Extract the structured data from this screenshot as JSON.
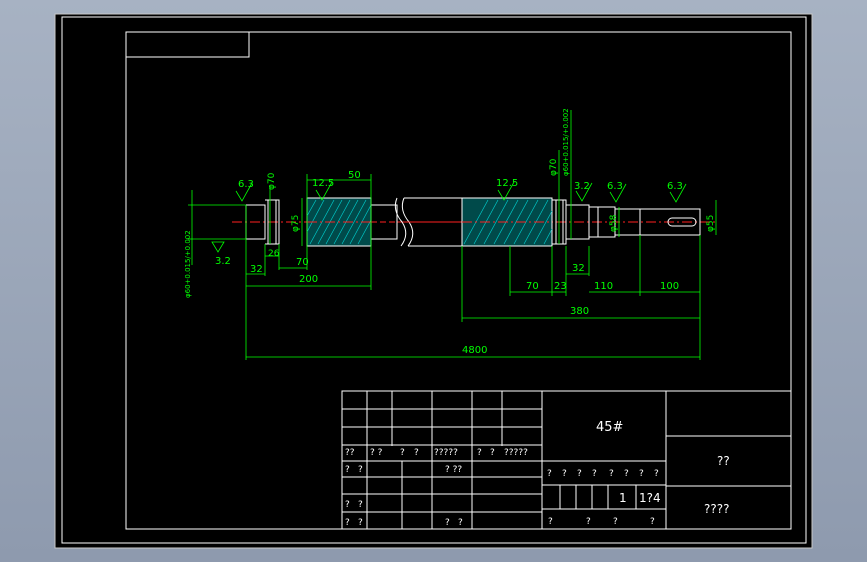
{
  "colors": {
    "viewport_bg": "#000000",
    "frame": "#ffffff",
    "dimension": "#00ff00",
    "centerline": "#ff2020",
    "hatch": "#00c8c8",
    "text": "#ffffff"
  },
  "drawing": {
    "roughness": {
      "r1": "6.3",
      "r2": "12.5",
      "r3": "12.5",
      "r4": "3.2",
      "r5": "6.3",
      "r6": "6.3",
      "r7": "3.2"
    },
    "diameters": {
      "d70_left": "φ70",
      "d75": "φ75",
      "d70_right": "φ70",
      "d60_right": "φ60+0.015/+0.002",
      "d58": "φ58",
      "d55": "φ55",
      "d60_left": "φ60+0.015/+0.002"
    },
    "dims": {
      "d50": "50",
      "d26": "26",
      "d32_left": "32",
      "d70_left": "70",
      "d200": "200",
      "d70_right": "70",
      "d23": "23",
      "d32_right": "32",
      "d110": "110",
      "d100": "100",
      "d380": "380",
      "d4800": "4800"
    }
  },
  "title_block": {
    "material": "45#",
    "part_name": "??",
    "drawing_no": "????",
    "left_row1": [
      "??",
      "? ?",
      "?",
      "?",
      "?????",
      "?",
      "?",
      "?????"
    ],
    "left_row2": [
      "?",
      "?",
      "? ??"
    ],
    "left_row3": [
      "?",
      "?"
    ],
    "left_row4": [
      "?",
      "?",
      "?",
      "?"
    ],
    "mid_row1": [
      "?",
      "?",
      "?",
      "?",
      "?",
      "?",
      "?",
      "?"
    ],
    "quantity": "1",
    "scale": "1?4",
    "mid_row3": [
      "?",
      "?",
      "?",
      "?"
    ]
  }
}
